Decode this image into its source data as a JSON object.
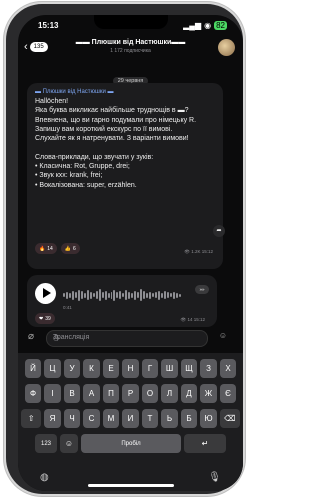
{
  "status": {
    "time": "15:13",
    "signal": "...",
    "battery": "82"
  },
  "header": {
    "back_count": "135",
    "title": "▬▬ Плюшки від Настюшки▬▬",
    "subtitle": "1 172 подписчика"
  },
  "date_label": "29 червня",
  "post": {
    "author": "▬ Плюшки від Настюшки ▬",
    "text": "Hallöchen!\nЯка буква викликає найбільше труднощів в ▬? Впевнена, що ви гарно подумали про німецьку R.\nЗапишу вам короткий екскурс по її вимові.\nСлухайте як я натренувати. З варіанти вимови!\n\nСлова-приклади, що звучати у зуків:\n• Класична: Rot, Gruppe, drei;\n• Звук кхх: krank, frei;\n• Вокалізована: super, erzählen.",
    "reactions": [
      {
        "emoji": "🔥",
        "count": "14"
      },
      {
        "emoji": "👍",
        "count": "6"
      }
    ],
    "views": "👁 1.2K 15:12"
  },
  "voice": {
    "duration": "0:41",
    "size": "»»",
    "reaction_count": "39",
    "views": "👁 14 15:12"
  },
  "input": {
    "placeholder": "Трансляція"
  },
  "keyboard": {
    "row1": [
      "Й",
      "Ц",
      "У",
      "К",
      "Е",
      "Н",
      "Г",
      "Ш",
      "Щ",
      "З",
      "Х"
    ],
    "row2": [
      "Ф",
      "І",
      "В",
      "А",
      "П",
      "Р",
      "О",
      "Л",
      "Д",
      "Ж",
      "Є"
    ],
    "row3": [
      "Я",
      "Ч",
      "С",
      "М",
      "И",
      "Т",
      "Ь",
      "Б",
      "Ю"
    ],
    "num_key": "123",
    "space": "Пробіл",
    "return_icon": "return-icon"
  }
}
